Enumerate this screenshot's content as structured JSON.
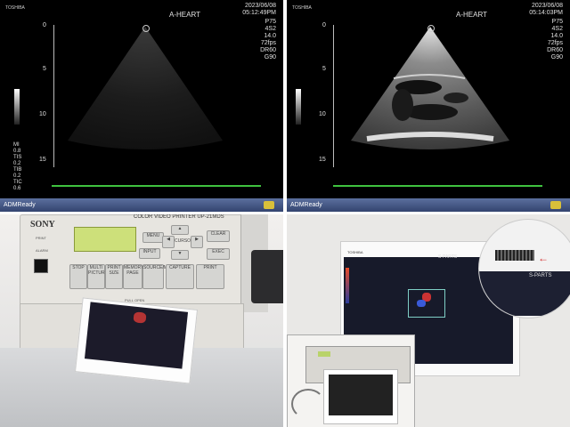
{
  "panels": {
    "left_scan": {
      "brand": "TOSHIBA",
      "mode": "A-HEART",
      "date": "2023/06/08",
      "time": "05:12:49PM",
      "params": [
        "P75",
        "4S2",
        "14.0",
        "72fps",
        "DR60",
        "G90"
      ],
      "depth_marks": [
        "0",
        "5",
        "10",
        "15"
      ],
      "indices": [
        "MI",
        "0.8",
        "TIS",
        "0.2",
        "TIB",
        "0.2",
        "TIC",
        "0.6"
      ],
      "status": "ADMReady"
    },
    "right_scan": {
      "brand": "TOSHIBA",
      "mode": "A-HEART",
      "date": "2023/06/08",
      "time": "05:14:03PM",
      "params": [
        "P75",
        "4S2",
        "14.0",
        "72fps",
        "DR60",
        "G90"
      ],
      "depth_marks": [
        "0",
        "5",
        "10",
        "15"
      ],
      "status": "ADMReady"
    },
    "printer": {
      "brand": "SONY",
      "model_line": "COLOR VIDEO PRINTER  UP-21MDS",
      "buttons": [
        "STOP",
        "MULTI PICTURE",
        "PRINT SIZE",
        "MEMORY PAGE",
        "SOURCE/MEMORY",
        "CAPTURE",
        "PRINT"
      ],
      "nav": [
        "MENU",
        "CURSOR",
        "CLEAR",
        "INPUT",
        "EXEC"
      ],
      "left_labels": [
        "PRINT",
        "ALARM"
      ],
      "door": "PULL OPEN"
    },
    "printout": {
      "header": "S-PARTS",
      "brand": "TOSHIBA"
    }
  }
}
